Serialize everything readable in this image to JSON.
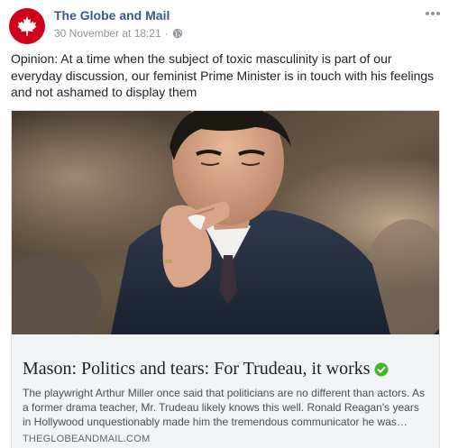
{
  "post": {
    "page_name": "The Globe and Mail",
    "timestamp": "30 November at 18:21",
    "separator": "·",
    "privacy_icon": "globe-icon",
    "caption": "Opinion: At a time when the subject of toxic masculinity is part of our everyday discussion, our feminist Prime Minister is in touch with his feelings and not ashamed to display them",
    "avatar_icon": "maple-leaf-icon",
    "more_icon": "more-options-icon"
  },
  "link_card": {
    "image_description_icon": "article-photo",
    "headline": "Mason: Politics and tears: For Trudeau, it works",
    "description": "The playwright Arthur Miller once said that politicians are no different than actors. As a former drama teacher, Mr. Trudeau likely knows this well. Ronald Reagan's years in Hollywood unquestionably made him the tremendous communicator he was…",
    "domain": "THEGLOBEANDMAIL.COM",
    "verified_icon": "verified-check-icon"
  },
  "colors": {
    "brand_red": "#d0021b",
    "link_blue": "#365899",
    "meta_gray": "#90949c",
    "verified_green": "#42b72a",
    "card_bg": "#f2f3f5"
  }
}
